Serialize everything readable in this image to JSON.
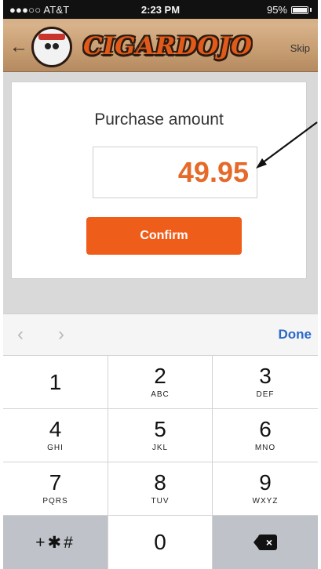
{
  "status_bar": {
    "carrier": "●●●○○ AT&T",
    "time": "2:23 PM",
    "battery": "95%"
  },
  "header": {
    "logo_text": "CIGARDOJO",
    "skip_label": "Skip",
    "back_icon": "back-arrow-icon"
  },
  "purchase": {
    "label": "Purchase amount",
    "amount_value": "49.95",
    "confirm_label": "Confirm",
    "accent_color": "#ef5d1a"
  },
  "accessory": {
    "done_label": "Done",
    "prev_icon": "chevron-left-icon",
    "next_icon": "chevron-right-icon"
  },
  "keypad": {
    "keys": [
      {
        "num": "1",
        "letters": ""
      },
      {
        "num": "2",
        "letters": "ABC"
      },
      {
        "num": "3",
        "letters": "DEF"
      },
      {
        "num": "4",
        "letters": "GHI"
      },
      {
        "num": "5",
        "letters": "JKL"
      },
      {
        "num": "6",
        "letters": "MNO"
      },
      {
        "num": "7",
        "letters": "PQRS"
      },
      {
        "num": "8",
        "letters": "TUV"
      },
      {
        "num": "9",
        "letters": "WXYZ"
      },
      {
        "num": "+✱#",
        "letters": ""
      },
      {
        "num": "0",
        "letters": ""
      },
      {
        "num": "",
        "letters": ""
      }
    ],
    "backspace_icon": "backspace-icon"
  }
}
